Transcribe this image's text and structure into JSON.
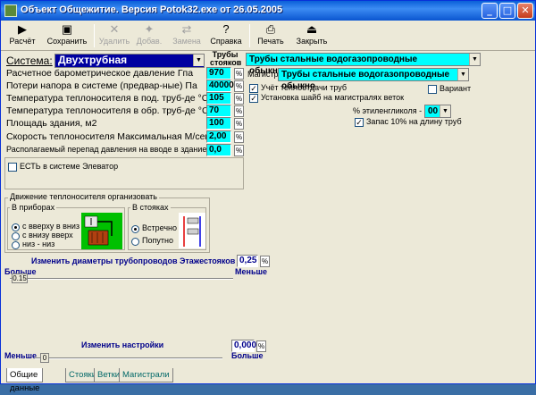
{
  "window": {
    "title": "Объект Общежитие. Версия Potok32.exe от 26.05.2005"
  },
  "toolbar": [
    {
      "label": "Расчёт",
      "icon": "run-icon",
      "glyph": "▶",
      "enabled": true
    },
    {
      "label": "Сохранить",
      "icon": "save-icon",
      "glyph": "▣",
      "enabled": true
    },
    {
      "label": "Удалить",
      "icon": "delete-icon",
      "glyph": "✕",
      "enabled": false
    },
    {
      "label": "Добав.",
      "icon": "add-icon",
      "glyph": "✦",
      "enabled": false
    },
    {
      "label": "Замена",
      "icon": "replace-icon",
      "glyph": "⇄",
      "enabled": false
    },
    {
      "label": "Справка",
      "icon": "help-icon",
      "glyph": "?",
      "enabled": true
    },
    {
      "label": "Печать",
      "icon": "print-icon",
      "glyph": "⎙",
      "enabled": true
    },
    {
      "label": "Закрыть",
      "icon": "close-door-icon",
      "glyph": "⏏",
      "enabled": true
    }
  ],
  "system": {
    "label": "Система:",
    "value": "Двухтрубная"
  },
  "pipes_label": "Трубы стояков",
  "params": [
    {
      "label": "Расчетное барометрическое давление  Гпа",
      "value": "970"
    },
    {
      "label": "Потери напора в системе (предвар-ные)  Па",
      "value": "40000"
    },
    {
      "label": "Температура теплоносителя в под. труб-де °С",
      "value": "105"
    },
    {
      "label": "Температура теплоносителя в обр. труб-де °С",
      "value": "70"
    },
    {
      "label": "Площадь здания, м2",
      "value": "100"
    },
    {
      "label": "Скорость теплоносителя Максимальная М/сек",
      "value": "2,00"
    },
    {
      "label": "Располагаемый перепад давления на вводе  в здание  КПа",
      "value": "0,0"
    }
  ],
  "riser_pipes": "Трубы стальные водогазопроводные обыкновенные",
  "main_label": "Магистр",
  "main_pipes": "Трубы стальные водогазопроводные обыкно",
  "checks": {
    "heat_transfer": {
      "label": "Учёт теплоотдачи труб",
      "checked": true
    },
    "washers": {
      "label": "Установка шайб на магистралях веток",
      "checked": true
    },
    "variant": {
      "label": "Вариант",
      "checked": false
    },
    "elevator": {
      "label": "ЕСТЬ в системе Элеватор",
      "checked": false
    },
    "reserve": {
      "label": "Запас 10% на длину труб",
      "checked": true
    }
  },
  "glycol": {
    "label": "% этиленгликоля -",
    "value": "00"
  },
  "flow_group": {
    "title": "Движение теплоносителя организовать",
    "devices_title": "В приборах",
    "devices": [
      {
        "label": "с вверху в вниз",
        "selected": true
      },
      {
        "label": "с внизу вверх",
        "selected": false
      },
      {
        "label": "низ - низ",
        "selected": false
      }
    ],
    "risers_title": "В стояках",
    "risers": [
      {
        "label": "Встречно",
        "selected": true
      },
      {
        "label": "Попутно",
        "selected": false
      }
    ]
  },
  "diameters": {
    "label": "Изменить диаметры трубопроводов Этажестояков",
    "value": "0,25",
    "more": "Больше",
    "less": "Меньше",
    "slider_value": "0.15"
  },
  "settings": {
    "label": "Изменить настройки",
    "value": "0,000",
    "more": "Больше",
    "less": "Меньше",
    "slider_value": "0"
  },
  "tabs": [
    "Общие данные",
    "Стояки",
    "Ветки",
    "Магистрали"
  ],
  "colors": {
    "input": "#00ffff",
    "system_combo": "#0000a0",
    "title_blue": "#00008b"
  }
}
